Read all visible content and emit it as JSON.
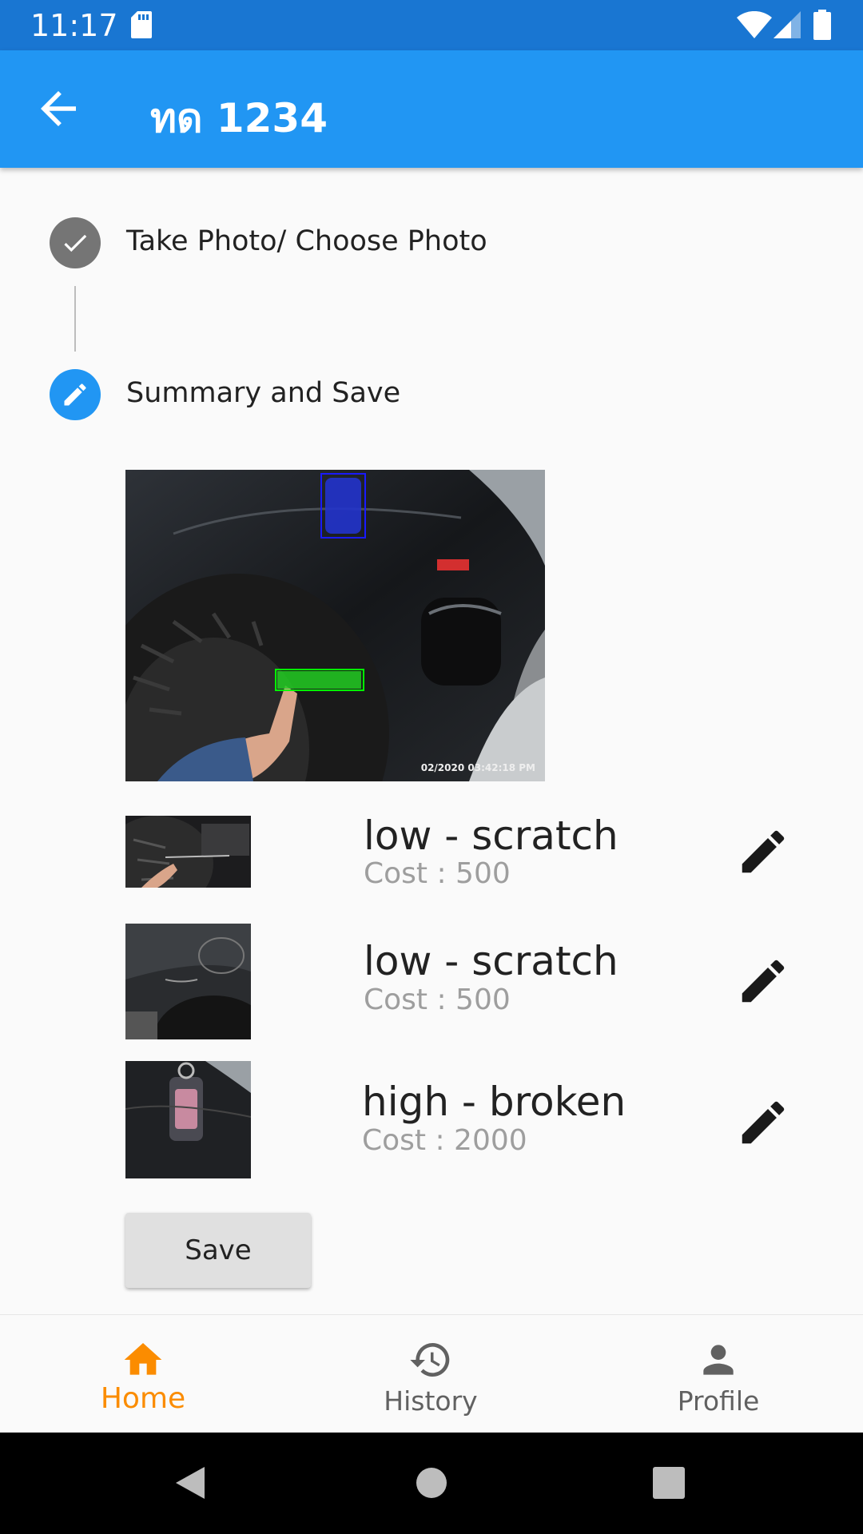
{
  "status_bar": {
    "time": "11:17"
  },
  "app_bar": {
    "title": "ทด 1234"
  },
  "steps": [
    {
      "label": "Take Photo/ Choose Photo",
      "state": "completed",
      "color": "#757575"
    },
    {
      "label": "Summary and Save",
      "state": "editing",
      "color": "#2196f3"
    }
  ],
  "photo": {
    "timestamp": "02/2020 03:42:18 PM"
  },
  "damages": [
    {
      "title": "low - scratch",
      "cost": "Cost : 500"
    },
    {
      "title": "low - scratch",
      "cost": "Cost : 500"
    },
    {
      "title": "high - broken",
      "cost": "Cost : 2000"
    }
  ],
  "save_label": "Save",
  "bottom_nav": {
    "items": [
      {
        "label": "Home",
        "icon": "home-icon",
        "active": true
      },
      {
        "label": "History",
        "icon": "history-icon",
        "active": false
      },
      {
        "label": "Profile",
        "icon": "person-icon",
        "active": false
      }
    ]
  },
  "colors": {
    "primary": "#2196f3",
    "status_bar": "#1976d2",
    "active_nav": "#fb8c00",
    "inactive_nav": "#616161"
  }
}
